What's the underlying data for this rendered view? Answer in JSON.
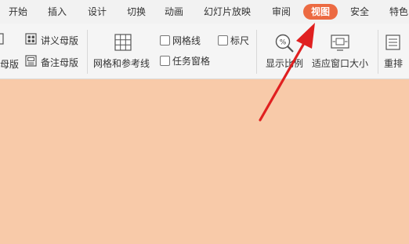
{
  "tabs": [
    {
      "label": "开始"
    },
    {
      "label": "插入"
    },
    {
      "label": "设计"
    },
    {
      "label": "切换"
    },
    {
      "label": "动画"
    },
    {
      "label": "幻灯片放映"
    },
    {
      "label": "审阅"
    },
    {
      "label": "视图",
      "active": true
    },
    {
      "label": "安全"
    },
    {
      "label": "特色"
    }
  ],
  "ribbon": {
    "master_partial": "母版",
    "handout_master": "讲义母版",
    "notes_master": "备注母版",
    "grid_guides": "网格和参考线",
    "gridlines": "网格线",
    "ruler": "标尺",
    "task_pane": "任务窗格",
    "zoom": "显示比例",
    "fit_window": "适应窗口大小",
    "rearrange": "重排"
  },
  "colors": {
    "active_tab": "#ec6a42",
    "canvas": "#f8caa9",
    "arrow": "#e02020"
  }
}
